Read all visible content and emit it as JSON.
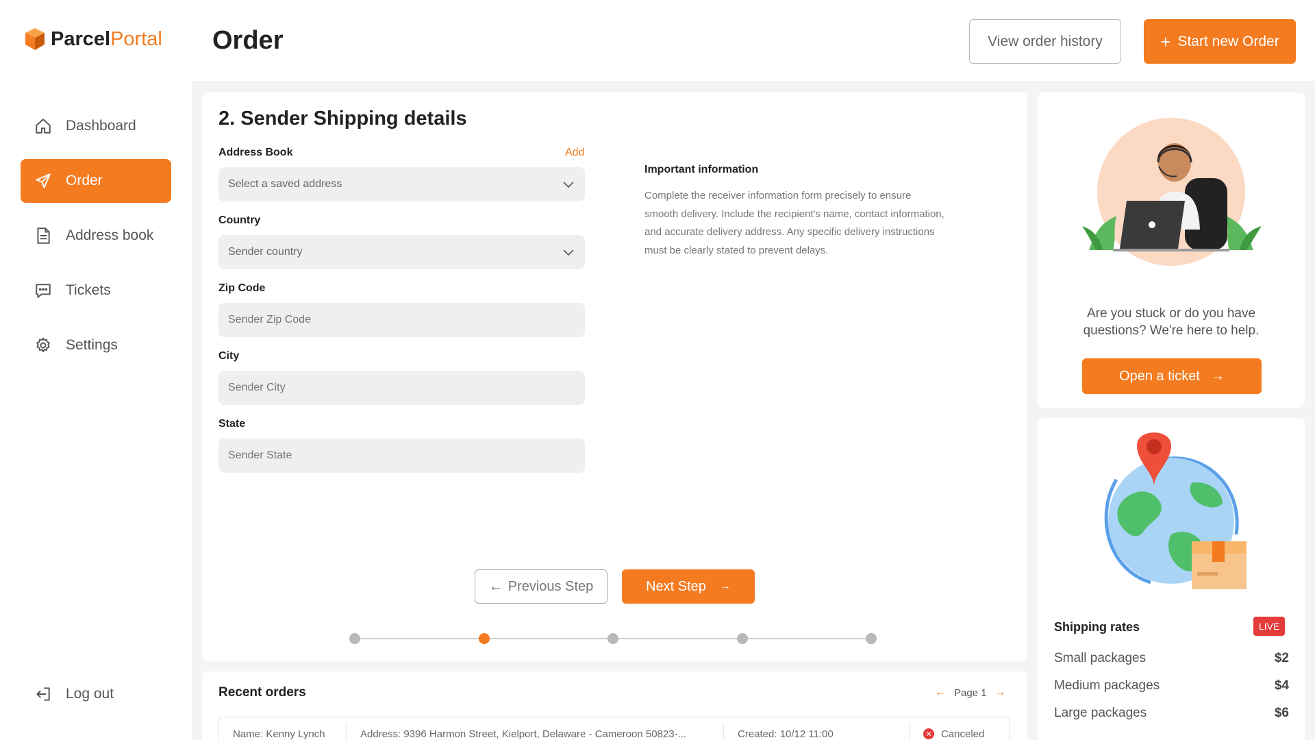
{
  "brand": {
    "part1": "Parcel",
    "part2": "Portal",
    "accent": "#f47b20"
  },
  "sidebar": {
    "items": [
      {
        "label": "Dashboard",
        "icon": "home-icon"
      },
      {
        "label": "Order",
        "icon": "send-icon",
        "active": true
      },
      {
        "label": "Address book",
        "icon": "document-icon"
      },
      {
        "label": "Tickets",
        "icon": "chat-icon"
      },
      {
        "label": "Settings",
        "icon": "gear-icon"
      }
    ],
    "logout_label": "Log out"
  },
  "header": {
    "title": "Order",
    "history_label": "View order history",
    "new_order_label": "Start new Order"
  },
  "form": {
    "title": "2. Sender Shipping details",
    "address_book": {
      "label": "Address Book",
      "add_label": "Add",
      "placeholder": "Select a saved address"
    },
    "country": {
      "label": "Country",
      "placeholder": "Sender country"
    },
    "zip": {
      "label": "Zip Code",
      "placeholder": "Sender Zip Code"
    },
    "city": {
      "label": "City",
      "placeholder": "Sender City"
    },
    "state": {
      "label": "State",
      "placeholder": "Sender State"
    },
    "info": {
      "title": "Important information",
      "text": "Complete the receiver information form precisely to ensure smooth delivery. Include the recipient's name, contact information, and accurate delivery address. Any specific delivery instructions must be clearly stated to prevent delays."
    },
    "prev_label": "Previous Step",
    "next_label": "Next Step",
    "steps_total": 5,
    "current_step": 2
  },
  "orders": {
    "title": "Recent orders",
    "page_label": "Page 1",
    "rows": [
      {
        "name": "Name: Kenny Lynch",
        "address": "Address: 9396 Harmon Street, Kielport, Delaware - Cameroon 50823-...",
        "created": "Created: 10/12 11:00",
        "status": "Canceled"
      }
    ]
  },
  "help": {
    "text": "Are you stuck or do you have questions? We're here to help.",
    "button_label": "Open a ticket"
  },
  "rates": {
    "title": "Shipping rates",
    "badge": "LIVE",
    "items": [
      {
        "label": "Small packages",
        "price": "$2"
      },
      {
        "label": "Medium packages",
        "price": "$4"
      },
      {
        "label": "Large packages",
        "price": "$6"
      }
    ]
  }
}
